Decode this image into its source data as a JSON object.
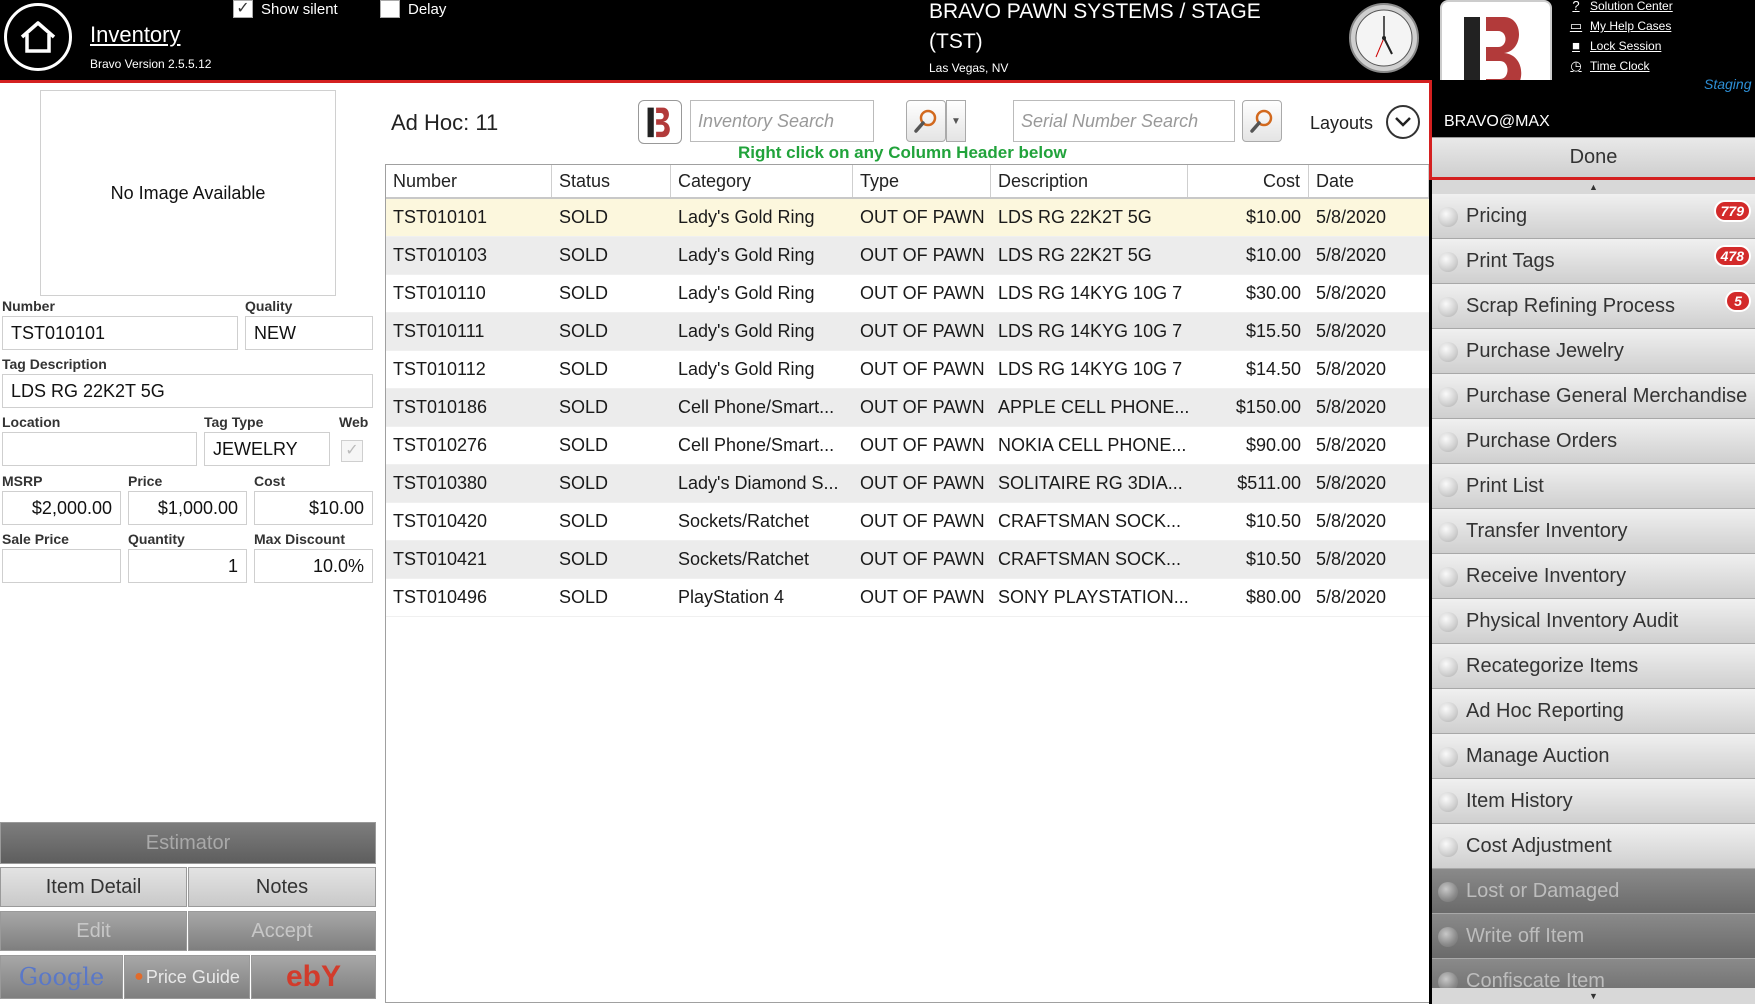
{
  "header": {
    "title": "Inventory",
    "version": "Bravo Version 2.5.5.12",
    "show_silent_label": "Show silent",
    "show_silent_checked": true,
    "delay_label": "Delay",
    "delay_checked": false,
    "company": "BRAVO PAWN SYSTEMS / STAGE (TST)",
    "city": "Las Vegas, NV",
    "user": "BRAVO@MAX",
    "links": [
      {
        "label": "Solution Center",
        "icon": "question-circle-icon"
      },
      {
        "label": "My Help Cases",
        "icon": "folder-icon"
      },
      {
        "label": "Lock Session",
        "icon": "lock-icon"
      },
      {
        "label": "Time Clock",
        "icon": "clock-icon"
      }
    ],
    "environment": "Staging"
  },
  "item": {
    "no_image": "No Image Available",
    "labels": {
      "number": "Number",
      "quality": "Quality",
      "tag_description": "Tag Description",
      "location": "Location",
      "tag_type": "Tag Type",
      "web": "Web",
      "msrp": "MSRP",
      "price": "Price",
      "cost": "Cost",
      "sale_price": "Sale Price",
      "quantity": "Quantity",
      "max_discount": "Max Discount"
    },
    "number": "TST010101",
    "quality": "NEW",
    "tag_description": "LDS RG 22K2T 5G",
    "location": "",
    "tag_type": "JEWELRY",
    "web_checked": true,
    "msrp": "$2,000.00",
    "price": "$1,000.00",
    "cost": "$10.00",
    "sale_price": "",
    "quantity": "1",
    "max_discount": "10.0%"
  },
  "left_buttons": {
    "estimator": "Estimator",
    "item_detail": "Item Detail",
    "notes": "Notes",
    "edit": "Edit",
    "accept": "Accept",
    "google": "Google",
    "price_guide": "Price Guide",
    "ebay": "ebY"
  },
  "toolbar": {
    "adhoc_label": "Ad Hoc: 11",
    "inventory_search_placeholder": "Inventory Search",
    "serial_search_placeholder": "Serial Number Search",
    "layouts_label": "Layouts",
    "hint": "Right click on any Column Header below"
  },
  "table": {
    "columns": [
      "Number",
      "Status",
      "Category",
      "Type",
      "Description",
      "Cost",
      "Date"
    ],
    "rows": [
      [
        "TST010101",
        "SOLD",
        "Lady's Gold Ring",
        "OUT OF PAWN",
        "LDS RG 22K2T 5G",
        "$10.00",
        "5/8/2020"
      ],
      [
        "TST010103",
        "SOLD",
        "Lady's Gold Ring",
        "OUT OF PAWN",
        "LDS RG 22K2T 5G",
        "$10.00",
        "5/8/2020"
      ],
      [
        "TST010110",
        "SOLD",
        "Lady's Gold Ring",
        "OUT OF PAWN",
        "LDS RG 14KYG 10G 7",
        "$30.00",
        "5/8/2020"
      ],
      [
        "TST010111",
        "SOLD",
        "Lady's Gold Ring",
        "OUT OF PAWN",
        "LDS RG 14KYG 10G 7",
        "$15.50",
        "5/8/2020"
      ],
      [
        "TST010112",
        "SOLD",
        "Lady's Gold Ring",
        "OUT OF PAWN",
        "LDS RG 14KYG 10G 7",
        "$14.50",
        "5/8/2020"
      ],
      [
        "TST010186",
        "SOLD",
        "Cell Phone/Smart...",
        "OUT OF PAWN",
        "APPLE CELL PHONE...",
        "$150.00",
        "5/8/2020"
      ],
      [
        "TST010276",
        "SOLD",
        "Cell Phone/Smart...",
        "OUT OF PAWN",
        "NOKIA CELL PHONE...",
        "$90.00",
        "5/8/2020"
      ],
      [
        "TST010380",
        "SOLD",
        "Lady's Diamond S...",
        "OUT OF PAWN",
        "SOLITAIRE RG 3DIA...",
        "$511.00",
        "5/8/2020"
      ],
      [
        "TST010420",
        "SOLD",
        "Sockets/Ratchet",
        "OUT OF PAWN",
        "CRAFTSMAN SOCK...",
        "$10.50",
        "5/8/2020"
      ],
      [
        "TST010421",
        "SOLD",
        "Sockets/Ratchet",
        "OUT OF PAWN",
        "CRAFTSMAN SOCK...",
        "$10.50",
        "5/8/2020"
      ],
      [
        "TST010496",
        "SOLD",
        "PlayStation 4",
        "OUT OF PAWN",
        "SONY PLAYSTATION...",
        "$80.00",
        "5/8/2020"
      ]
    ],
    "selected_row": 0
  },
  "right_menu": {
    "done_label": "Done",
    "items": [
      {
        "label": "Pricing",
        "badge": "779",
        "enabled": true
      },
      {
        "label": "Print Tags",
        "badge": "478",
        "enabled": true
      },
      {
        "label": "Scrap Refining Process",
        "badge": "5",
        "enabled": true
      },
      {
        "label": "Purchase Jewelry",
        "badge": "",
        "enabled": true
      },
      {
        "label": "Purchase General Merchandise",
        "badge": "",
        "enabled": true
      },
      {
        "label": "Purchase Orders",
        "badge": "",
        "enabled": true
      },
      {
        "label": "Print List",
        "badge": "",
        "enabled": true
      },
      {
        "label": "Transfer Inventory",
        "badge": "",
        "enabled": true
      },
      {
        "label": "Receive Inventory",
        "badge": "",
        "enabled": true
      },
      {
        "label": "Physical Inventory Audit",
        "badge": "",
        "enabled": true
      },
      {
        "label": "Recategorize Items",
        "badge": "",
        "enabled": true
      },
      {
        "label": "Ad Hoc Reporting",
        "badge": "",
        "enabled": true
      },
      {
        "label": "Manage Auction",
        "badge": "",
        "enabled": true
      },
      {
        "label": "Item History",
        "badge": "",
        "enabled": true
      },
      {
        "label": "Cost Adjustment",
        "badge": "",
        "enabled": true
      },
      {
        "label": "Lost or Damaged",
        "badge": "",
        "enabled": false
      },
      {
        "label": "Write off Item",
        "badge": "",
        "enabled": false
      },
      {
        "label": "Confiscate Item",
        "badge": "",
        "enabled": false
      }
    ]
  },
  "colors": {
    "accent_red": "#d42020",
    "hint_green": "#21a33b",
    "selected_row": "#fcf7dd",
    "badge_red": "#d32a2a",
    "staging_blue": "#2d8fd6"
  }
}
